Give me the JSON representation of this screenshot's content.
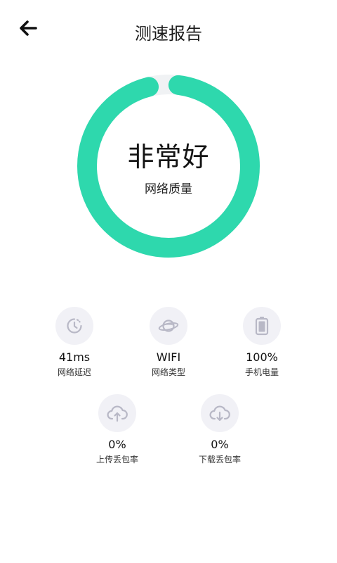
{
  "header": {
    "title": "测速报告",
    "back_icon": "arrow-left-icon"
  },
  "gauge": {
    "status": "非常好",
    "label": "网络质量",
    "fill_fraction": 0.98,
    "color": "#2ED8AD",
    "track_color": "#F0F2F4"
  },
  "stats": [
    {
      "icon": "clock-icon",
      "value": "41ms",
      "label": "网络延迟"
    },
    {
      "icon": "planet-icon",
      "value": "WIFI",
      "label": "网络类型"
    },
    {
      "icon": "battery-icon",
      "value": "100%",
      "label": "手机电量"
    },
    {
      "icon": "cloud-upload-icon",
      "value": "0%",
      "label": "上传丢包率"
    },
    {
      "icon": "cloud-download-icon",
      "value": "0%",
      "label": "下载丢包率"
    }
  ],
  "colors": {
    "icon_bg": "#F1F1F6",
    "icon_fg": "#B8B8C6"
  }
}
